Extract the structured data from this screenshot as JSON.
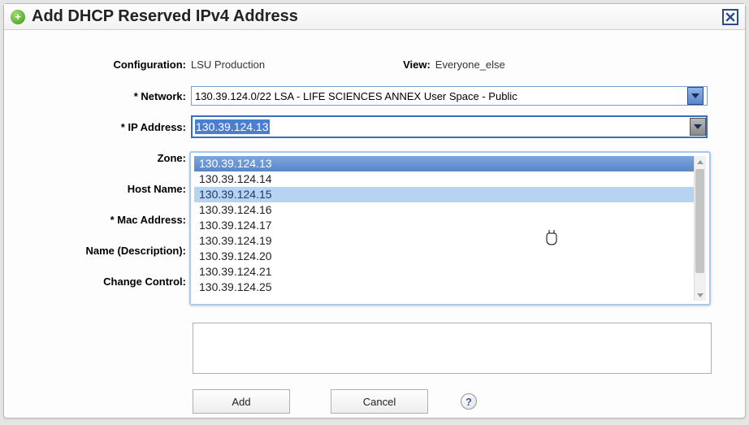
{
  "title": "Add DHCP Reserved IPv4 Address",
  "fields": {
    "configuration_label": "Configuration:",
    "configuration_value": "LSU Production",
    "view_label": "View:",
    "view_value": "Everyone_else",
    "network_label": "* Network:",
    "network_value": "130.39.124.0/22 LSA - LIFE SCIENCES ANNEX User Space - Public",
    "ip_label": "* IP Address:",
    "ip_value": "130.39.124.13",
    "zone_label": "Zone:",
    "host_label": "Host Name:",
    "mac_label": "* Mac Address:",
    "name_desc_label": "Name (Description):",
    "change_ctrl_label": "Change Control:"
  },
  "dropdown": {
    "items": [
      "130.39.124.13",
      "130.39.124.14",
      "130.39.124.15",
      "130.39.124.16",
      "130.39.124.17",
      "130.39.124.19",
      "130.39.124.20",
      "130.39.124.21",
      "130.39.124.25"
    ],
    "selected_index": 0,
    "hover_index": 2
  },
  "buttons": {
    "add": "Add",
    "cancel": "Cancel"
  },
  "help_symbol": "?"
}
